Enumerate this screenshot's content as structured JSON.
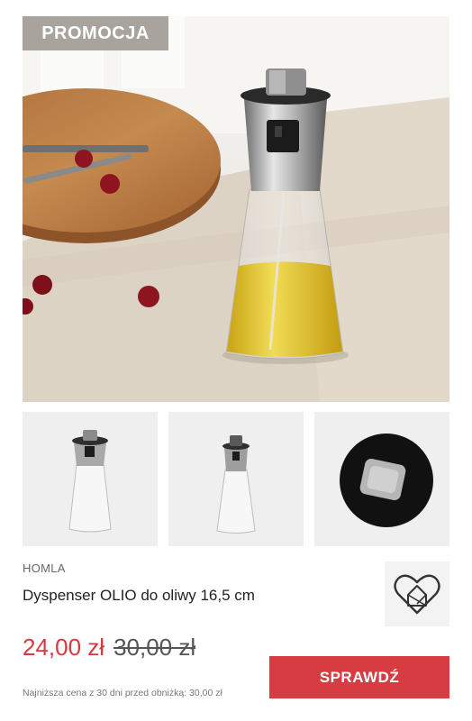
{
  "badge": {
    "label": "PROMOCJA"
  },
  "product": {
    "brand": "HOMLA",
    "title": "Dyspenser OLIO do oliwy 16,5 cm",
    "price_current": "24,00 zł",
    "price_old": "30,00 zł",
    "lowest_price_note": "Najniższa cena z 30 dni przed obniżką: 30,00 zł"
  },
  "actions": {
    "check_label": "SPRAWDŹ"
  },
  "colors": {
    "accent": "#d63c41",
    "badge_bg": "#a8a39c",
    "price_current": "#d43a3f"
  },
  "icons": {
    "favorite": "heart-house-icon"
  }
}
